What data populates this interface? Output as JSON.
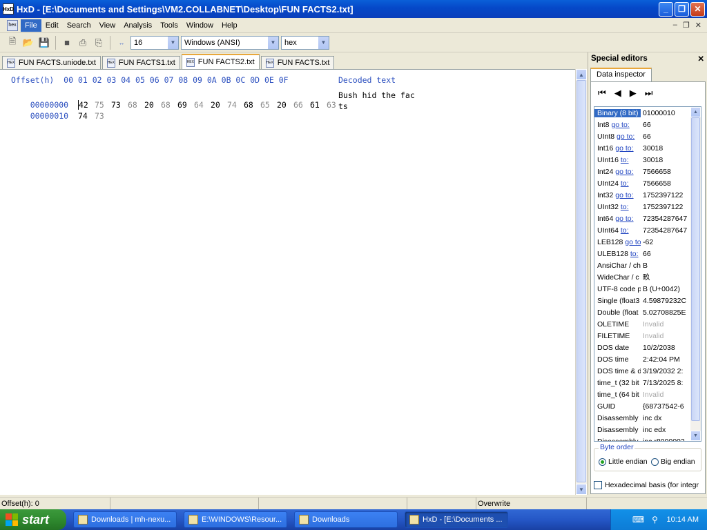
{
  "window": {
    "app_icon": "HxD",
    "title": "HxD - [E:\\Documents and Settings\\VM2.COLLABNET\\Desktop\\FUN FACTS2.txt]",
    "buttons": {
      "minimize": "_",
      "maximize": "❐",
      "close": "✕"
    }
  },
  "menu": {
    "items": [
      "File",
      "Edit",
      "Search",
      "View",
      "Analysis",
      "Tools",
      "Window",
      "Help"
    ],
    "active": "File",
    "mdi_controls": {
      "minimize": "–",
      "restore": "❐",
      "close": "✕"
    }
  },
  "toolbar": {
    "bytes_per_row": "16",
    "charset": "Windows (ANSI)",
    "offset_base": "hex"
  },
  "tabs": [
    {
      "label": "FUN FACTS.uniode.txt",
      "active": false
    },
    {
      "label": "FUN FACTS1.txt",
      "active": false
    },
    {
      "label": "FUN FACTS2.txt",
      "active": true
    },
    {
      "label": "FUN FACTS.txt",
      "active": false
    }
  ],
  "editor": {
    "header_offset": "Offset(h)",
    "header_columns": "00 01 02 03 04 05 06 07 08 09 0A 0B 0C 0D 0E 0F",
    "header_decoded": "Decoded text",
    "rows": [
      {
        "offset": "00000000",
        "bytes": [
          "42",
          "75",
          "73",
          "68",
          "20",
          "68",
          "69",
          "64",
          "20",
          "74",
          "68",
          "65",
          "20",
          "66",
          "61",
          "63"
        ],
        "decoded": "Bush hid the fac"
      },
      {
        "offset": "00000010",
        "bytes": [
          "74",
          "73"
        ],
        "decoded": "ts"
      }
    ]
  },
  "special_editors": {
    "title": "Special editors",
    "close": "✕",
    "tab": "Data inspector",
    "nav": {
      "first": "⏮",
      "prev": "◀",
      "next": "▶",
      "last": "⏭"
    },
    "rows": [
      {
        "label": "Binary (8 bit)",
        "goto": "",
        "value": "01000010",
        "selected": true,
        "invalid": false
      },
      {
        "label": "Int8",
        "goto": "go to:",
        "value": "66",
        "selected": false,
        "invalid": false
      },
      {
        "label": "UInt8",
        "goto": "go to:",
        "value": "66",
        "selected": false,
        "invalid": false
      },
      {
        "label": "Int16",
        "goto": "go to:",
        "value": "30018",
        "selected": false,
        "invalid": false
      },
      {
        "label": "UInt16",
        "goto": "to:",
        "value": "30018",
        "selected": false,
        "invalid": false
      },
      {
        "label": "Int24",
        "goto": "go to:",
        "value": "7566658",
        "selected": false,
        "invalid": false
      },
      {
        "label": "UInt24",
        "goto": "to:",
        "value": "7566658",
        "selected": false,
        "invalid": false
      },
      {
        "label": "Int32",
        "goto": "go to:",
        "value": "1752397122",
        "selected": false,
        "invalid": false
      },
      {
        "label": "UInt32",
        "goto": "to:",
        "value": "1752397122",
        "selected": false,
        "invalid": false
      },
      {
        "label": "Int64",
        "goto": "go to:",
        "value": "72354287647",
        "selected": false,
        "invalid": false
      },
      {
        "label": "UInt64",
        "goto": "to:",
        "value": "72354287647",
        "selected": false,
        "invalid": false
      },
      {
        "label": "LEB128",
        "goto": "go to:",
        "value": "-62",
        "selected": false,
        "invalid": false
      },
      {
        "label": "ULEB128",
        "goto": "to:",
        "value": "66",
        "selected": false,
        "invalid": false
      },
      {
        "label": "AnsiChar / ch",
        "goto": "",
        "value": "B",
        "selected": false,
        "invalid": false
      },
      {
        "label": "WideChar / c",
        "goto": "",
        "value": "畂",
        "selected": false,
        "invalid": false
      },
      {
        "label": "UTF-8 code p",
        "goto": "",
        "value": "B (U+0042)",
        "selected": false,
        "invalid": false
      },
      {
        "label": "Single (float3",
        "goto": "",
        "value": "4.59879232C",
        "selected": false,
        "invalid": false
      },
      {
        "label": "Double (float",
        "goto": "",
        "value": "5.02708825E",
        "selected": false,
        "invalid": false
      },
      {
        "label": "OLETIME",
        "goto": "",
        "value": "Invalid",
        "selected": false,
        "invalid": true
      },
      {
        "label": "FILETIME",
        "goto": "",
        "value": "Invalid",
        "selected": false,
        "invalid": true
      },
      {
        "label": "DOS date",
        "goto": "",
        "value": "10/2/2038",
        "selected": false,
        "invalid": false
      },
      {
        "label": "DOS time",
        "goto": "",
        "value": "2:42:04 PM",
        "selected": false,
        "invalid": false
      },
      {
        "label": "DOS time & d",
        "goto": "",
        "value": "3/19/2032 2:",
        "selected": false,
        "invalid": false
      },
      {
        "label": "time_t (32 bit",
        "goto": "",
        "value": "7/13/2025 8:",
        "selected": false,
        "invalid": false
      },
      {
        "label": "time_t (64 bit",
        "goto": "",
        "value": "Invalid",
        "selected": false,
        "invalid": true
      },
      {
        "label": "GUID",
        "goto": "",
        "value": "{68737542-6",
        "selected": false,
        "invalid": false
      },
      {
        "label": "Disassembly (",
        "goto": "",
        "value": "inc dx",
        "selected": false,
        "invalid": false
      },
      {
        "label": "Disassembly (",
        "goto": "",
        "value": "inc edx",
        "selected": false,
        "invalid": false
      },
      {
        "label": "Disassembly (",
        "goto": "",
        "value": "inc r8000002",
        "selected": false,
        "invalid": false
      }
    ],
    "byte_order": {
      "legend": "Byte order",
      "little": "Little endian",
      "big": "Big endian",
      "selected": "little"
    },
    "hex_basis": "Hexadecimal basis (for integr"
  },
  "status": {
    "offset": "Offset(h): 0",
    "mode": "Overwrite"
  },
  "taskbar": {
    "start": "start",
    "tasks": [
      {
        "label": "Downloads | mh-nexu...",
        "active": false
      },
      {
        "label": "E:\\WINDOWS\\Resour...",
        "active": false
      },
      {
        "label": "Downloads",
        "active": false
      },
      {
        "label": "HxD - [E:\\Documents ...",
        "active": true
      }
    ],
    "clock": "10:14 AM"
  }
}
